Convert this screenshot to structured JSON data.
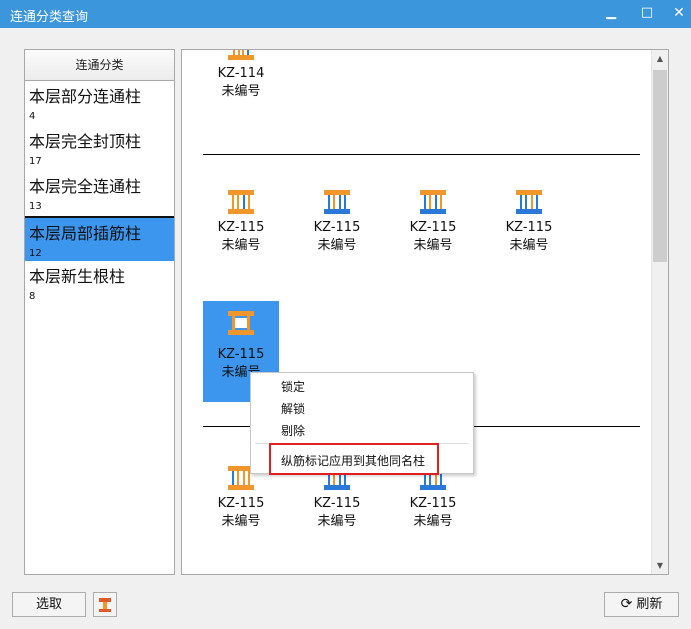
{
  "window": {
    "title": "连通分类查询",
    "minimize_glyph": "▁",
    "maximize_glyph": "□",
    "close_glyph": "✕"
  },
  "left_panel": {
    "header": "连通分类",
    "categories": [
      {
        "name": "本层部分连通柱",
        "count": "4"
      },
      {
        "name": "本层完全封顶柱",
        "count": "17"
      },
      {
        "name": "本层完全连通柱",
        "count": "13"
      },
      {
        "name": "本层局部插筋柱",
        "count": "12",
        "selected": true
      },
      {
        "name": "本层新生根柱",
        "count": "8"
      }
    ]
  },
  "right_panel": {
    "groups": [
      {
        "items": [
          {
            "code": "KZ-114",
            "status": "未编号"
          }
        ]
      },
      {
        "items": [
          {
            "code": "KZ-115",
            "status": "未编号"
          },
          {
            "code": "KZ-115",
            "status": "未编号"
          },
          {
            "code": "KZ-115",
            "status": "未编号"
          },
          {
            "code": "KZ-115",
            "status": "未编号"
          },
          {
            "code": "KZ-115",
            "status": "未编号",
            "selected": true
          }
        ]
      },
      {
        "items": [
          {
            "code": "KZ-115",
            "status": "未编号"
          },
          {
            "code": "KZ-115",
            "status": "未编号"
          },
          {
            "code": "KZ-115",
            "status": "未编号"
          }
        ]
      }
    ],
    "scroll_up_glyph": "▲",
    "scroll_down_glyph": "▼"
  },
  "context_menu": {
    "items": [
      "锁定",
      "解锁",
      "剔除"
    ],
    "highlighted_item": "纵筋标记应用到其他同名柱"
  },
  "buttons": {
    "select": "选取",
    "refresh": "刷新",
    "refresh_glyph": "⟳"
  },
  "colors": {
    "titlebar": "#3c96dc",
    "selection": "#3c96ee",
    "icon_orange": "#f0962a",
    "icon_blue": "#2a78d8",
    "highlight_border": "#e02020"
  }
}
